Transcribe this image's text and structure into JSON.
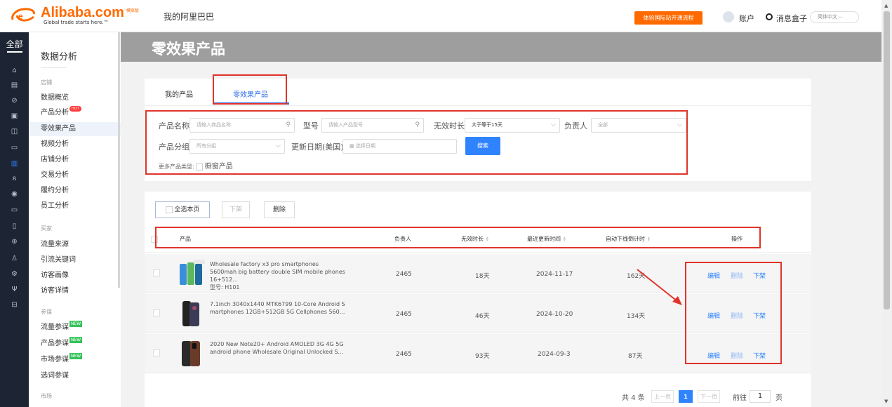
{
  "header": {
    "logo_main": "Alibaba.com",
    "logo_sub": "Global trade starts here.™",
    "logo_badge": "模拟版",
    "title": "我的阿里巴巴",
    "cta": "体验国际站开通流程",
    "account": "账户",
    "messages": "消息盒子",
    "language": "简体中文"
  },
  "rail": {
    "all_label": "全部",
    "icons": [
      "home-icon",
      "store-icon",
      "shield-icon",
      "box-icon",
      "chart-icon",
      "monitor-icon",
      "bar-chart-icon",
      "people-icon",
      "signal-icon",
      "card-icon",
      "clipboard-icon",
      "globe-icon",
      "user-check-icon",
      "settings-icon",
      "gift-icon",
      "sign-icon"
    ]
  },
  "subnav": {
    "title": "数据分析",
    "groups": {
      "store": "店铺",
      "buyer": "买家",
      "reference": "参谋",
      "market": "市场"
    },
    "items": {
      "overview": "数据概览",
      "product_analysis": "产品分析",
      "zero_effect": "零效果产品",
      "video_analysis": "视频分析",
      "store_analysis": "店铺分析",
      "trade_analysis": "交易分析",
      "fulfillment": "履约分析",
      "staff": "员工分析",
      "traffic_source": "流量来源",
      "keywords": "引流关键词",
      "visitor_profile": "访客画像",
      "visitor_detail": "访客详情",
      "traffic_ref": "流量参谋",
      "product_ref": "产品参谋",
      "market_ref": "市场参谋",
      "keyword_ref": "选词参谋"
    },
    "badges": {
      "hot": "HOT",
      "new": "NEW"
    }
  },
  "page": {
    "title": "零效果产品"
  },
  "tabs": {
    "my_products": "我的产品",
    "zero_effect": "零效果产品"
  },
  "filters": {
    "name_label": "产品名称",
    "name_placeholder": "请输入商品名称",
    "model_label": "型号",
    "model_placeholder": "请输入产品型号",
    "invalid_label": "无效时长",
    "invalid_value": "大于等于15天",
    "owner_label": "负责人",
    "owner_value": "全部",
    "group_label": "产品分组",
    "group_value": "所有分组",
    "date_label": "更新日期(美国)",
    "date_placeholder": "选择日期",
    "search_button": "搜索",
    "more_type_label": "更多产品类型:",
    "showcase_label": "橱窗产品"
  },
  "actions": {
    "select_page": "全选本页",
    "unlist": "下架",
    "delete": "删除"
  },
  "table": {
    "columns": {
      "product": "产品",
      "owner": "负责人",
      "invalid_duration": "无效时长",
      "last_update": "最近更新时间",
      "auto_delist": "自动下线倒计时",
      "operation": "操作"
    },
    "sort_icon": "⇕",
    "rows": [
      {
        "name": "Wholesale factory x3 pro smartphones 5600mah big battery double SIM mobile phones 16+512...",
        "model": "型号: H101",
        "owner": "2465",
        "invalid": "18天",
        "updated": "2024-11-17",
        "countdown": "162天",
        "edit": "编辑",
        "delete": "删除",
        "unlist": "下架"
      },
      {
        "name": "7.1inch 3040x1440 MTK6799 10-Core Android S martphones 12GB+512GB 5G Cellphones 560...",
        "model": "",
        "owner": "2465",
        "invalid": "46天",
        "updated": "2024-10-20",
        "countdown": "134天",
        "edit": "编辑",
        "delete": "删除",
        "unlist": "下架"
      },
      {
        "name": "2020 New Note20+ Android AMOLED 3G 4G 5G android phone Wholesale Original Unlocked S...",
        "model": "",
        "owner": "2465",
        "invalid": "93天",
        "updated": "2024-09-3",
        "countdown": "87天",
        "edit": "编辑",
        "delete": "删除",
        "unlist": "下架"
      }
    ]
  },
  "pagination": {
    "total": "共 4 条",
    "prev": "上一页",
    "current": "1",
    "next": "下一页",
    "goto": "前往",
    "page_input": "1",
    "page_unit": "页"
  },
  "colors": {
    "brand_orange": "#ff6a00",
    "primary_blue": "#2f83ff",
    "annotation_red": "#e0342a",
    "rail_dark": "#1d2433"
  }
}
